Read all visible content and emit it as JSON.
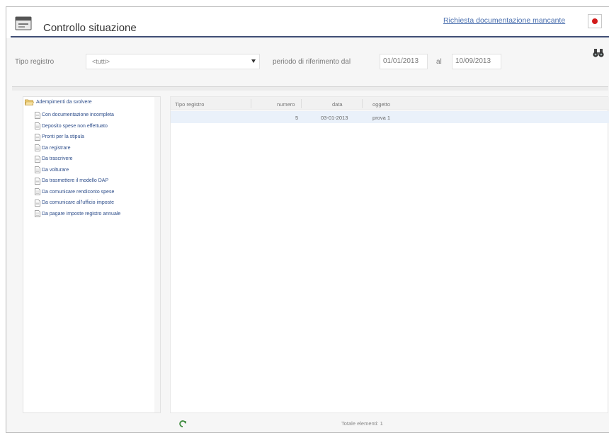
{
  "header": {
    "title": "Controllo situazione",
    "link": "Richiesta documentazione mancante",
    "app_icon": "window-icon",
    "exit_icon": "exit-icon"
  },
  "filters": {
    "tipo_label": "Tipo registro",
    "tipo_value": "<tutti>",
    "periodo_label": "periodo di riferimento dal",
    "date_from": "01/01/2013",
    "al_label": "al",
    "date_to": "10/09/2013",
    "search_icon": "binoculars-icon"
  },
  "tree": {
    "root": "Adempimenti da svolvere",
    "items": [
      "Con documentazione incompleta",
      "Deposito spese non effettuato",
      "Pronti per la stipula",
      "Da registrare",
      "Da trascrivere",
      "Da volturare",
      "Da trasmettere il modello DAP",
      "Da comunicare rendiconto spese",
      "Da comunicare all'ufficio imposte",
      "Da pagare imposte registro annuale"
    ]
  },
  "grid": {
    "columns": [
      "Tipo registro",
      "numero",
      "data",
      "oggetto"
    ],
    "rows": [
      {
        "tipo": "",
        "numero": "5",
        "data": "03-01-2013",
        "oggetto": "prova 1"
      }
    ],
    "total": "Totale elementi: 1"
  },
  "colors": {
    "accent": "#3f4d74",
    "link": "#4a6fae",
    "exit": "#d21a1a",
    "selected_row": "#eaf1fa"
  }
}
